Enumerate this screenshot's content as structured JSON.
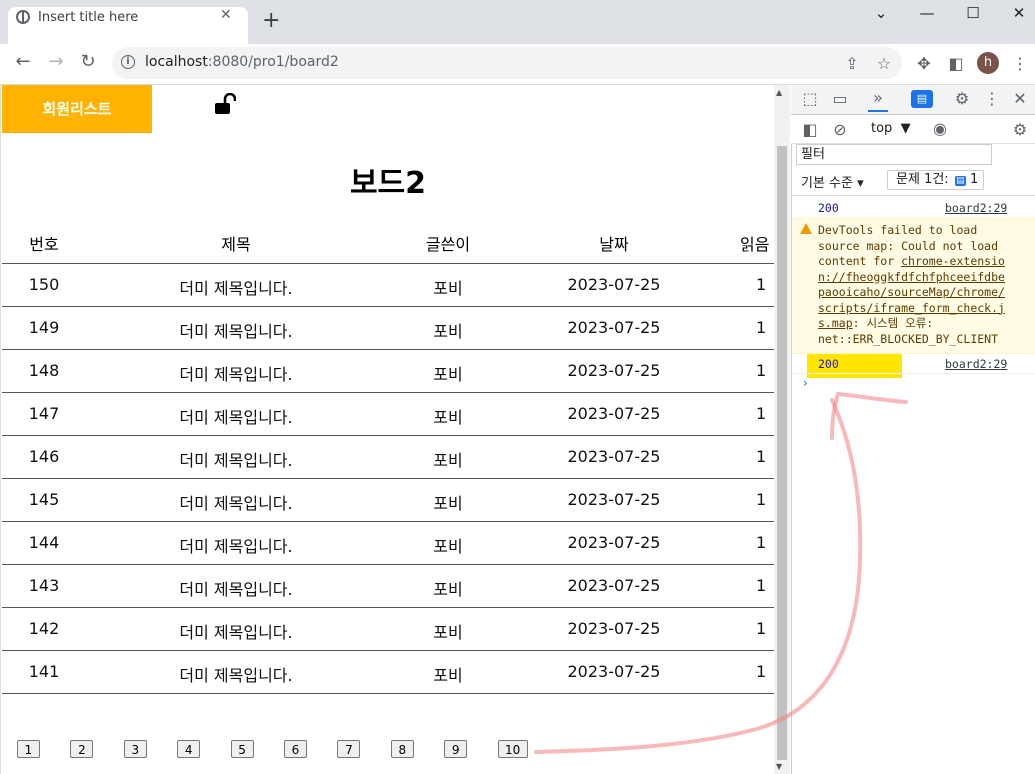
{
  "browser": {
    "tab_title": "Insert title here",
    "tab_close": "✕",
    "new_tab": "+",
    "window_controls": {
      "dropdown": "⌄",
      "minimize": "—",
      "maximize": "☐",
      "close": "✕"
    },
    "url_host": "localhost",
    "url_rest": ":8080/pro1/board2",
    "avatar_letter": "h",
    "nav": {
      "back": "←",
      "forward": "→",
      "reload": "↻"
    },
    "toolbar_icons": [
      "share-icon",
      "star-icon",
      "extensions-icon",
      "sidepanel-icon"
    ]
  },
  "page": {
    "member_list_button": "회원리스트",
    "title": "보드2",
    "columns": [
      "번호",
      "제목",
      "글쓴이",
      "날짜",
      "읽음"
    ],
    "rows": [
      {
        "no": "150",
        "title": "더미 제목입니다.",
        "author": "포비",
        "date": "2023-07-25",
        "views": "1"
      },
      {
        "no": "149",
        "title": "더미 제목입니다.",
        "author": "포비",
        "date": "2023-07-25",
        "views": "1"
      },
      {
        "no": "148",
        "title": "더미 제목입니다.",
        "author": "포비",
        "date": "2023-07-25",
        "views": "1"
      },
      {
        "no": "147",
        "title": "더미 제목입니다.",
        "author": "포비",
        "date": "2023-07-25",
        "views": "1"
      },
      {
        "no": "146",
        "title": "더미 제목입니다.",
        "author": "포비",
        "date": "2023-07-25",
        "views": "1"
      },
      {
        "no": "145",
        "title": "더미 제목입니다.",
        "author": "포비",
        "date": "2023-07-25",
        "views": "1"
      },
      {
        "no": "144",
        "title": "더미 제목입니다.",
        "author": "포비",
        "date": "2023-07-25",
        "views": "1"
      },
      {
        "no": "143",
        "title": "더미 제목입니다.",
        "author": "포비",
        "date": "2023-07-25",
        "views": "1"
      },
      {
        "no": "142",
        "title": "더미 제목입니다.",
        "author": "포비",
        "date": "2023-07-25",
        "views": "1"
      },
      {
        "no": "141",
        "title": "더미 제목입니다.",
        "author": "포비",
        "date": "2023-07-25",
        "views": "1"
      }
    ],
    "pages": [
      "1",
      "2",
      "3",
      "4",
      "5",
      "6",
      "7",
      "8",
      "9",
      "10"
    ],
    "accent_color": "#ffb300"
  },
  "devtools": {
    "context": "top",
    "filter_placeholder": "필터",
    "levels": "기본 수준 ▾",
    "issues_label": "문제 1건:",
    "issues_count": "1",
    "logs": [
      {
        "value": "200",
        "source": "board2:29"
      },
      {
        "value": "200",
        "source": "board2:29"
      }
    ],
    "warning": {
      "line1": "DevTools failed to load",
      "line2": "source map: Could not load",
      "line3": "content for ",
      "link1": "chrome-extensio",
      "link2": "n://fheoggkfdfchfphceeifdbe",
      "link3": "paooicaho/sourceMap/chrome/",
      "link4": "scripts/iframe_form_check.j",
      "link5": "s.map",
      "line_tail": ": 시스템 오류:",
      "line_last": "net::ERR_BLOCKED_BY_CLIENT"
    },
    "prompt": "›",
    "highlight_color": "#ffe500"
  }
}
